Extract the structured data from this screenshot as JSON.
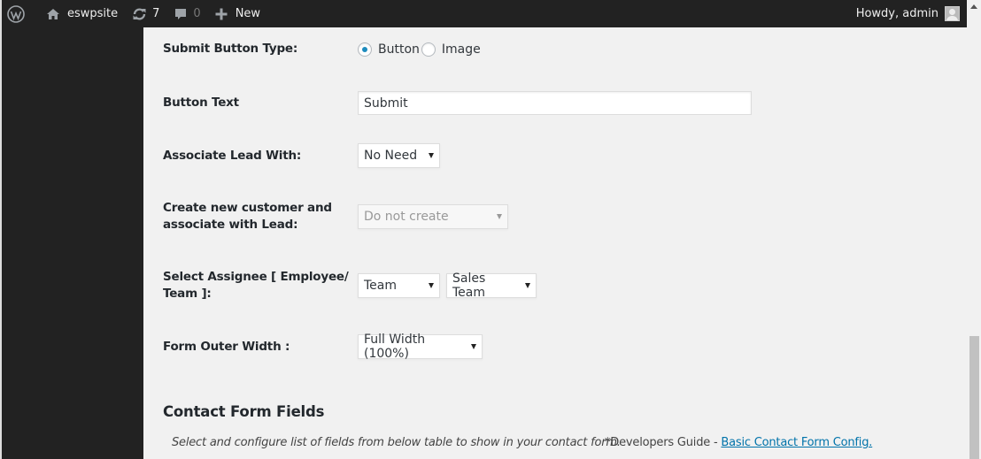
{
  "adminbar": {
    "site_name": "eswpsite",
    "updates_count": "7",
    "comments_count": "0",
    "new_label": "New",
    "greeting": "Howdy, admin"
  },
  "form": {
    "submit_button_type": {
      "label": "Submit Button Type:",
      "options": [
        {
          "label": "Button",
          "checked": true
        },
        {
          "label": "Image",
          "checked": false
        }
      ]
    },
    "button_text": {
      "label": "Button Text",
      "value": "Submit"
    },
    "associate_lead": {
      "label": "Associate Lead With:",
      "value": "No Need"
    },
    "create_customer": {
      "label_line1": "Create new customer and",
      "label_line2": "associate with Lead:",
      "value": "Do not create",
      "disabled": true
    },
    "assignee": {
      "label_line1": "Select Assignee [ Employee/",
      "label_line2": "Team ]:",
      "type_value": "Team",
      "team_value": "Sales Team"
    },
    "outer_width": {
      "label": "Form Outer Width :",
      "value": "Full Width (100%)"
    }
  },
  "contact_fields": {
    "title": "Contact Form Fields",
    "description": "Select and configure list of fields from below table to show in your contact form.",
    "guide_prefix": "*Developers Guide - ",
    "guide_link": "Basic Contact Form Config."
  },
  "colors": {
    "adminbar_bg": "#222222",
    "content_bg": "#f1f1f1",
    "link": "#0073aa",
    "radio_dot": "#1e8cbe"
  }
}
